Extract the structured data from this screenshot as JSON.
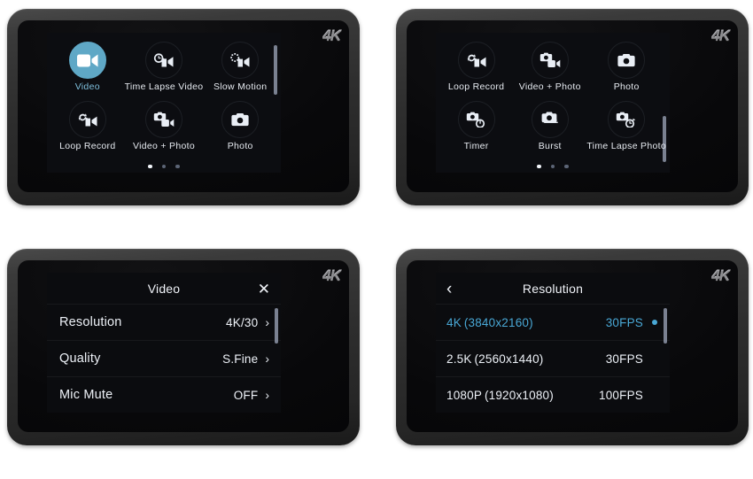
{
  "devices": [
    {
      "badge": "4K",
      "screen_type": "mode-grid",
      "page_indicator": {
        "total": 3,
        "active": 1
      },
      "modes": [
        {
          "label": "Video",
          "icon": "video-camcorder-icon",
          "active": true
        },
        {
          "label": "Time Lapse Video",
          "icon": "timelapse-video-icon",
          "active": false
        },
        {
          "label": "Slow Motion",
          "icon": "slow-motion-icon",
          "active": false
        },
        {
          "label": "Loop Record",
          "icon": "loop-record-icon",
          "active": false
        },
        {
          "label": "Video + Photo",
          "icon": "video-plus-photo-icon",
          "active": false
        },
        {
          "label": "Photo",
          "icon": "photo-camera-icon",
          "active": false
        }
      ]
    },
    {
      "badge": "4K",
      "screen_type": "mode-grid",
      "page_indicator": {
        "total": 3,
        "active": 1
      },
      "modes": [
        {
          "label": "Loop Record",
          "icon": "loop-record-icon",
          "active": false
        },
        {
          "label": "Video + Photo",
          "icon": "video-plus-photo-icon",
          "active": false
        },
        {
          "label": "Photo",
          "icon": "photo-camera-icon",
          "active": false
        },
        {
          "label": "Timer",
          "icon": "timer-camera-icon",
          "active": false
        },
        {
          "label": "Burst",
          "icon": "burst-camera-icon",
          "active": false
        },
        {
          "label": "Time Lapse Photo",
          "icon": "timelapse-photo-icon",
          "active": false
        }
      ]
    },
    {
      "badge": "4K",
      "screen_type": "settings-list",
      "header": {
        "title": "Video",
        "right_button": "✕",
        "right_button_name": "close-icon"
      },
      "rows": [
        {
          "label": "Resolution",
          "value": "4K/30",
          "chevron": "›"
        },
        {
          "label": "Quality",
          "value": "S.Fine",
          "chevron": "›"
        },
        {
          "label": "Mic Mute",
          "value": "OFF",
          "chevron": "›"
        }
      ]
    },
    {
      "badge": "4K",
      "screen_type": "resolution-list",
      "header": {
        "title": "Resolution",
        "left_button": "‹",
        "left_button_name": "back-icon"
      },
      "options": [
        {
          "name": "4K (3840x2160)",
          "fps": "30FPS",
          "selected": true
        },
        {
          "name": "2.5K (2560x1440)",
          "fps": "30FPS",
          "selected": false
        },
        {
          "name": "1080P (1920x1080)",
          "fps": "100FPS",
          "selected": false
        }
      ]
    }
  ],
  "colors": {
    "accent_active_circle": "#5fa8c6",
    "accent_selected_text": "#49a8d6",
    "screen_text": "#eef2f8",
    "bezel": "#2e2e2e",
    "badge": "#8d8d90"
  }
}
